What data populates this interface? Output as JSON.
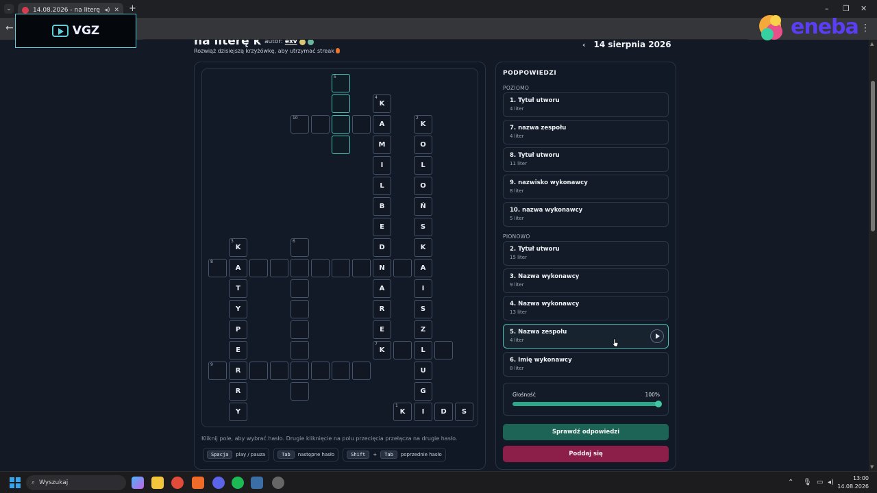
{
  "browser": {
    "tab_title": "14.08.2026 - na literę k | 1(",
    "tab_menu_icon": "chevron-down-icon",
    "new_tab": "+",
    "back": "←",
    "menu": "⋮"
  },
  "overlays": {
    "vgz_logo": "VGZ",
    "eneba_logo": "eneba"
  },
  "header": {
    "title": "na literę k",
    "author_label": "autor:",
    "author_name": "exv",
    "subtitle": "Rozwiąż dzisiejszą krzyżówkę, aby utrzymać streak",
    "date": "14 sierpnia 2026",
    "prev_icon": "‹"
  },
  "grid": {
    "cells": [
      {
        "c": 6,
        "r": 0,
        "n": "5",
        "hl": true
      },
      {
        "c": 6,
        "r": 1,
        "hl": true
      },
      {
        "c": 8,
        "r": 1,
        "n": "4",
        "l": "K"
      },
      {
        "c": 4,
        "r": 2,
        "n": "10"
      },
      {
        "c": 5,
        "r": 2
      },
      {
        "c": 6,
        "r": 2,
        "hl": true
      },
      {
        "c": 7,
        "r": 2
      },
      {
        "c": 8,
        "r": 2,
        "l": "A"
      },
      {
        "c": 10,
        "r": 2,
        "n": "2",
        "l": "K"
      },
      {
        "c": 6,
        "r": 3,
        "hl": true
      },
      {
        "c": 8,
        "r": 3,
        "l": "M"
      },
      {
        "c": 10,
        "r": 3,
        "l": "O"
      },
      {
        "c": 8,
        "r": 4,
        "l": "I"
      },
      {
        "c": 10,
        "r": 4,
        "l": "L"
      },
      {
        "c": 8,
        "r": 5,
        "l": "L"
      },
      {
        "c": 10,
        "r": 5,
        "l": "O"
      },
      {
        "c": 8,
        "r": 6,
        "l": "B"
      },
      {
        "c": 10,
        "r": 6,
        "l": "Ń"
      },
      {
        "c": 8,
        "r": 7,
        "l": "E"
      },
      {
        "c": 10,
        "r": 7,
        "l": "S"
      },
      {
        "c": 1,
        "r": 8,
        "n": "3",
        "l": "K"
      },
      {
        "c": 4,
        "r": 8,
        "n": "6"
      },
      {
        "c": 8,
        "r": 8,
        "l": "D"
      },
      {
        "c": 10,
        "r": 8,
        "l": "K"
      },
      {
        "c": 0,
        "r": 9,
        "n": "8"
      },
      {
        "c": 1,
        "r": 9,
        "l": "A"
      },
      {
        "c": 2,
        "r": 9
      },
      {
        "c": 3,
        "r": 9
      },
      {
        "c": 4,
        "r": 9
      },
      {
        "c": 5,
        "r": 9
      },
      {
        "c": 6,
        "r": 9
      },
      {
        "c": 7,
        "r": 9
      },
      {
        "c": 8,
        "r": 9,
        "l": "N"
      },
      {
        "c": 9,
        "r": 9
      },
      {
        "c": 10,
        "r": 9,
        "l": "A"
      },
      {
        "c": 1,
        "r": 10,
        "l": "T"
      },
      {
        "c": 4,
        "r": 10
      },
      {
        "c": 8,
        "r": 10,
        "l": "A"
      },
      {
        "c": 10,
        "r": 10,
        "l": "I"
      },
      {
        "c": 1,
        "r": 11,
        "l": "Y"
      },
      {
        "c": 4,
        "r": 11
      },
      {
        "c": 8,
        "r": 11,
        "l": "R"
      },
      {
        "c": 10,
        "r": 11,
        "l": "S"
      },
      {
        "c": 1,
        "r": 12,
        "l": "P"
      },
      {
        "c": 4,
        "r": 12
      },
      {
        "c": 8,
        "r": 12,
        "l": "E"
      },
      {
        "c": 10,
        "r": 12,
        "l": "Z"
      },
      {
        "c": 1,
        "r": 13,
        "l": "E"
      },
      {
        "c": 4,
        "r": 13
      },
      {
        "c": 8,
        "r": 13,
        "n": "7",
        "l": "K"
      },
      {
        "c": 9,
        "r": 13
      },
      {
        "c": 10,
        "r": 13,
        "l": "L"
      },
      {
        "c": 11,
        "r": 13
      },
      {
        "c": 0,
        "r": 14,
        "n": "9"
      },
      {
        "c": 1,
        "r": 14,
        "l": "R"
      },
      {
        "c": 2,
        "r": 14
      },
      {
        "c": 3,
        "r": 14
      },
      {
        "c": 4,
        "r": 14
      },
      {
        "c": 5,
        "r": 14
      },
      {
        "c": 6,
        "r": 14
      },
      {
        "c": 7,
        "r": 14
      },
      {
        "c": 10,
        "r": 14,
        "l": "U"
      },
      {
        "c": 1,
        "r": 15,
        "l": "R"
      },
      {
        "c": 4,
        "r": 15
      },
      {
        "c": 10,
        "r": 15,
        "l": "G"
      },
      {
        "c": 1,
        "r": 16,
        "l": "Y"
      },
      {
        "c": 9,
        "r": 16,
        "n": "1",
        "l": "K"
      },
      {
        "c": 10,
        "r": 16,
        "l": "I"
      },
      {
        "c": 11,
        "r": 16,
        "l": "D"
      },
      {
        "c": 12,
        "r": 16,
        "l": "S"
      }
    ]
  },
  "instructions": {
    "hint": "Kliknij pole, aby wybrać hasło. Drugie kliknięcie na polu przecięcia przełącza na drugie hasło.",
    "shortcut1_key": "Spacja",
    "shortcut1_desc": "play / pauza",
    "shortcut2_key": "Tab",
    "shortcut2_desc": "następne hasło",
    "shortcut3_key1": "Shift",
    "shortcut3_plus": "+",
    "shortcut3_key2": "Tab",
    "shortcut3_desc": "poprzednie hasło"
  },
  "clues": {
    "title": "PODPOWIEDZI",
    "across_label": "POZIOMO",
    "down_label": "PIONOWO",
    "across": [
      {
        "title": "1. Tytuł utworu",
        "len": "4 liter"
      },
      {
        "title": "7. nazwa zespołu",
        "len": "4 liter"
      },
      {
        "title": "8. Tytuł utworu",
        "len": "11 liter"
      },
      {
        "title": "9. nazwisko wykonawcy",
        "len": "8 liter"
      },
      {
        "title": "10. nazwa wykonawcy",
        "len": "5 liter"
      }
    ],
    "down": [
      {
        "title": "2. Tytuł utworu",
        "len": "15 liter"
      },
      {
        "title": "3. Nazwa wykonawcy",
        "len": "9 liter"
      },
      {
        "title": "4. Nazwa wykonawcy",
        "len": "13 liter"
      },
      {
        "title": "5. Nazwa zespołu",
        "len": "4 liter",
        "active": true
      },
      {
        "title": "6. Imię wykonawcy",
        "len": "8 liter"
      }
    ],
    "volume_label": "Głośność",
    "volume_value": "100%",
    "volume_level": 1.0,
    "check_button": "Sprawdź odpowiedzi",
    "give_up_button": "Poddaj się"
  },
  "taskbar": {
    "search_placeholder": "Wyszukaj",
    "time": "13:00",
    "date": "14.08.2026"
  },
  "colors": {
    "accent_teal": "#4fbfb4",
    "check_green": "#1d6456",
    "give_up_red": "#8c1f4a"
  }
}
